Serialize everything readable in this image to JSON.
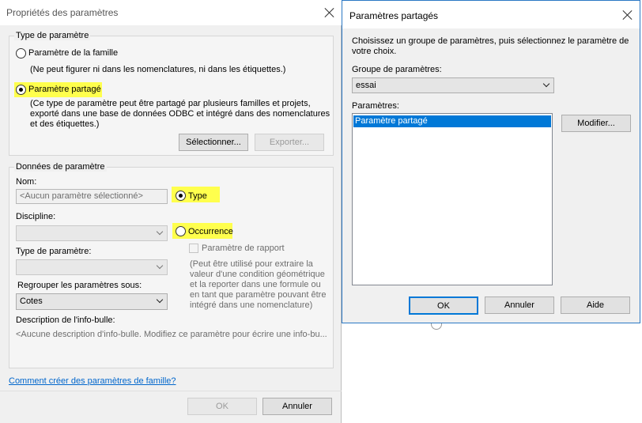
{
  "main_dialog": {
    "title": "Propriétés des paramètres",
    "param_type_group": {
      "legend": "Type de paramètre",
      "family_param_label": "Paramètre de la famille",
      "family_param_desc": "(Ne peut figurer ni dans les nomenclatures, ni dans les étiquettes.)",
      "shared_param_label": "Paramètre partagé",
      "shared_param_desc_line1": "(Ce type de paramètre peut être partagé par plusieurs familles et projets,",
      "shared_param_desc_line2": "exporté dans une base de données ODBC et intégré dans des nomenclatures",
      "shared_param_desc_line3": "et des étiquettes.)",
      "select_button": "Sélectionner...",
      "export_button": "Exporter..."
    },
    "param_data_group": {
      "legend": "Données de paramètre",
      "name_label": "Nom:",
      "name_placeholder": "<Aucun paramètre sélectionné>",
      "type_radio_label": "Type",
      "discipline_label": "Discipline:",
      "occurrence_radio_label": "Occurrence",
      "param_type_label": "Type de paramètre:",
      "report_param_label": "Paramètre de rapport",
      "report_desc_line1": "(Peut être utilisé pour extraire la",
      "report_desc_line2": "valeur d'une condition géométrique",
      "report_desc_line3": "et la reporter dans une formule ou",
      "report_desc_line4": "en tant que paramètre pouvant être",
      "report_desc_line5": "intégré dans une nomenclature)",
      "group_under_label": "Regrouper les paramètres sous:",
      "group_under_value": "Cotes",
      "tooltip_desc_label": "Description de l'info-bulle:",
      "tooltip_desc_value": "<Aucune description d'info-bulle. Modifiez ce paramètre pour écrire une info-bu..."
    },
    "help_link": "Comment créer des paramètres de famille?",
    "ok_button": "OK",
    "cancel_button": "Annuler"
  },
  "shared_dialog": {
    "title": "Paramètres partagés",
    "instruction_line1": "Choisissez un groupe de paramètres, puis sélectionnez le paramètre de",
    "instruction_line2": "votre choix.",
    "group_label": "Groupe de paramètres:",
    "group_value": "essai",
    "params_label": "Paramètres:",
    "params_list": [
      "Paramètre partagé"
    ],
    "modify_button": "Modifier...",
    "ok_button": "OK",
    "cancel_button": "Annuler",
    "help_button": "Aide"
  },
  "colors": {
    "highlight": "#ffff4d",
    "selection": "#0078d7",
    "link": "#0066cc"
  }
}
